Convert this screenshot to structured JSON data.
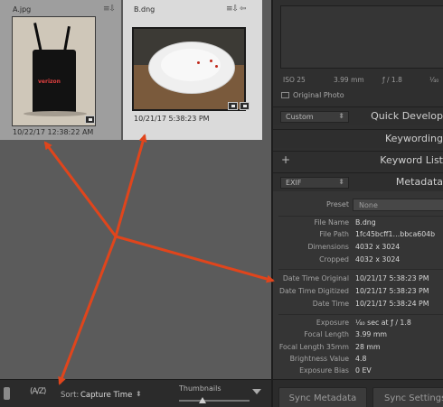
{
  "grid": {
    "cells": [
      {
        "filename": "A.jpg",
        "date": "10/22/17 12:38:22 AM",
        "photo_brand": "verizon"
      },
      {
        "filename": "B.dng",
        "date": "10/21/17 5:38:23 PM"
      }
    ],
    "cell_controls": [
      "≡⇩",
      "≡⇩ ⇦"
    ]
  },
  "toolbar": {
    "sort_dir_icon": "(A/Z)",
    "sort_label": "Sort:",
    "sort_value": "Capture Time",
    "sort_chevron": "⬍",
    "thumbnails_label": "Thumbnails",
    "thumbnails_level": 0.33
  },
  "histogram": {
    "iso": "ISO 25",
    "focal": "3.99 mm",
    "aperture": "ƒ / 1.8",
    "shutter": "¹⁄₄₀",
    "original_photo_label": "Original Photo"
  },
  "panels": {
    "quick_develop": {
      "preset": "Custom",
      "title": "Quick Develop"
    },
    "keywording": {
      "title": "Keywording"
    },
    "keyword_list": {
      "title": "Keyword List",
      "plus": "+"
    },
    "metadata": {
      "preset": "EXIF",
      "title": "Metadata"
    }
  },
  "metadata": {
    "preset_label": "Preset",
    "preset_value": "None",
    "rows": [
      {
        "k": "File Name",
        "v": "B.dng"
      },
      {
        "k": "File Path",
        "v": "1fc45bcff1…bbca604b"
      },
      {
        "k": "Dimensions",
        "v": "4032 x 3024"
      },
      {
        "k": "Cropped",
        "v": "4032 x 3024"
      },
      {
        "k": "Date Time Original",
        "v": "10/21/17 5:38:23 PM"
      },
      {
        "k": "Date Time Digitized",
        "v": "10/21/17 5:38:23 PM"
      },
      {
        "k": "Date Time",
        "v": "10/21/17 5:38:24 PM"
      },
      {
        "k": "Exposure",
        "v": "¹⁄₄₀ sec at ƒ / 1.8"
      },
      {
        "k": "Focal Length",
        "v": "3.99 mm"
      },
      {
        "k": "Focal Length 35mm",
        "v": "28 mm"
      },
      {
        "k": "Brightness Value",
        "v": "4.8"
      },
      {
        "k": "Exposure Bias",
        "v": "0 EV"
      }
    ]
  },
  "sync": {
    "metadata_label": "Sync Metadata",
    "settings_label": "Sync Settings"
  },
  "colors": {
    "arrow": "#e0451c",
    "grid_background": "#5b5b5b",
    "panel_background": "#2f2f2f"
  }
}
